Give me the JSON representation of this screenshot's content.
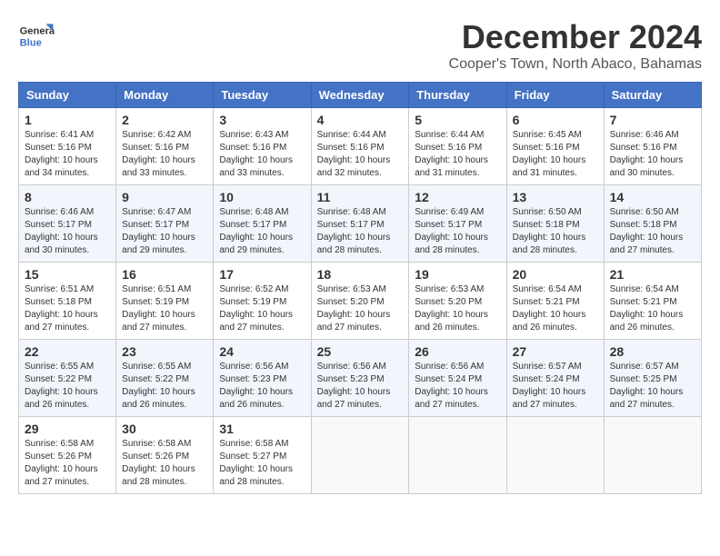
{
  "header": {
    "logo_line1": "General",
    "logo_line2": "Blue",
    "month": "December 2024",
    "location": "Cooper's Town, North Abaco, Bahamas"
  },
  "days_of_week": [
    "Sunday",
    "Monday",
    "Tuesday",
    "Wednesday",
    "Thursday",
    "Friday",
    "Saturday"
  ],
  "weeks": [
    [
      {
        "day": 1,
        "info": "Sunrise: 6:41 AM\nSunset: 5:16 PM\nDaylight: 10 hours\nand 34 minutes."
      },
      {
        "day": 2,
        "info": "Sunrise: 6:42 AM\nSunset: 5:16 PM\nDaylight: 10 hours\nand 33 minutes."
      },
      {
        "day": 3,
        "info": "Sunrise: 6:43 AM\nSunset: 5:16 PM\nDaylight: 10 hours\nand 33 minutes."
      },
      {
        "day": 4,
        "info": "Sunrise: 6:44 AM\nSunset: 5:16 PM\nDaylight: 10 hours\nand 32 minutes."
      },
      {
        "day": 5,
        "info": "Sunrise: 6:44 AM\nSunset: 5:16 PM\nDaylight: 10 hours\nand 31 minutes."
      },
      {
        "day": 6,
        "info": "Sunrise: 6:45 AM\nSunset: 5:16 PM\nDaylight: 10 hours\nand 31 minutes."
      },
      {
        "day": 7,
        "info": "Sunrise: 6:46 AM\nSunset: 5:16 PM\nDaylight: 10 hours\nand 30 minutes."
      }
    ],
    [
      {
        "day": 8,
        "info": "Sunrise: 6:46 AM\nSunset: 5:17 PM\nDaylight: 10 hours\nand 30 minutes."
      },
      {
        "day": 9,
        "info": "Sunrise: 6:47 AM\nSunset: 5:17 PM\nDaylight: 10 hours\nand 29 minutes."
      },
      {
        "day": 10,
        "info": "Sunrise: 6:48 AM\nSunset: 5:17 PM\nDaylight: 10 hours\nand 29 minutes."
      },
      {
        "day": 11,
        "info": "Sunrise: 6:48 AM\nSunset: 5:17 PM\nDaylight: 10 hours\nand 28 minutes."
      },
      {
        "day": 12,
        "info": "Sunrise: 6:49 AM\nSunset: 5:17 PM\nDaylight: 10 hours\nand 28 minutes."
      },
      {
        "day": 13,
        "info": "Sunrise: 6:50 AM\nSunset: 5:18 PM\nDaylight: 10 hours\nand 28 minutes."
      },
      {
        "day": 14,
        "info": "Sunrise: 6:50 AM\nSunset: 5:18 PM\nDaylight: 10 hours\nand 27 minutes."
      }
    ],
    [
      {
        "day": 15,
        "info": "Sunrise: 6:51 AM\nSunset: 5:18 PM\nDaylight: 10 hours\nand 27 minutes."
      },
      {
        "day": 16,
        "info": "Sunrise: 6:51 AM\nSunset: 5:19 PM\nDaylight: 10 hours\nand 27 minutes."
      },
      {
        "day": 17,
        "info": "Sunrise: 6:52 AM\nSunset: 5:19 PM\nDaylight: 10 hours\nand 27 minutes."
      },
      {
        "day": 18,
        "info": "Sunrise: 6:53 AM\nSunset: 5:20 PM\nDaylight: 10 hours\nand 27 minutes."
      },
      {
        "day": 19,
        "info": "Sunrise: 6:53 AM\nSunset: 5:20 PM\nDaylight: 10 hours\nand 26 minutes."
      },
      {
        "day": 20,
        "info": "Sunrise: 6:54 AM\nSunset: 5:21 PM\nDaylight: 10 hours\nand 26 minutes."
      },
      {
        "day": 21,
        "info": "Sunrise: 6:54 AM\nSunset: 5:21 PM\nDaylight: 10 hours\nand 26 minutes."
      }
    ],
    [
      {
        "day": 22,
        "info": "Sunrise: 6:55 AM\nSunset: 5:22 PM\nDaylight: 10 hours\nand 26 minutes."
      },
      {
        "day": 23,
        "info": "Sunrise: 6:55 AM\nSunset: 5:22 PM\nDaylight: 10 hours\nand 26 minutes."
      },
      {
        "day": 24,
        "info": "Sunrise: 6:56 AM\nSunset: 5:23 PM\nDaylight: 10 hours\nand 26 minutes."
      },
      {
        "day": 25,
        "info": "Sunrise: 6:56 AM\nSunset: 5:23 PM\nDaylight: 10 hours\nand 27 minutes."
      },
      {
        "day": 26,
        "info": "Sunrise: 6:56 AM\nSunset: 5:24 PM\nDaylight: 10 hours\nand 27 minutes."
      },
      {
        "day": 27,
        "info": "Sunrise: 6:57 AM\nSunset: 5:24 PM\nDaylight: 10 hours\nand 27 minutes."
      },
      {
        "day": 28,
        "info": "Sunrise: 6:57 AM\nSunset: 5:25 PM\nDaylight: 10 hours\nand 27 minutes."
      }
    ],
    [
      {
        "day": 29,
        "info": "Sunrise: 6:58 AM\nSunset: 5:26 PM\nDaylight: 10 hours\nand 27 minutes."
      },
      {
        "day": 30,
        "info": "Sunrise: 6:58 AM\nSunset: 5:26 PM\nDaylight: 10 hours\nand 28 minutes."
      },
      {
        "day": 31,
        "info": "Sunrise: 6:58 AM\nSunset: 5:27 PM\nDaylight: 10 hours\nand 28 minutes."
      },
      null,
      null,
      null,
      null
    ]
  ]
}
